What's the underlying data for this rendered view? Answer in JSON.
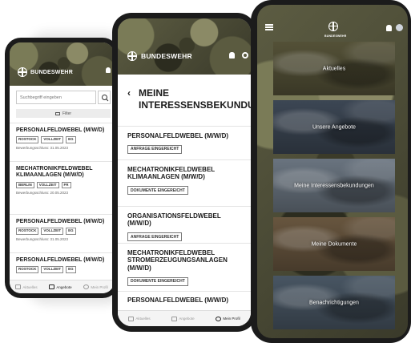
{
  "brand": {
    "name": "BUNDESWEHR"
  },
  "colors": {
    "camo_base": "#4a4a36",
    "header_text": "#ffffff",
    "body_text": "#1b1b1b",
    "device_frame": "#1b1b1b"
  },
  "phone1": {
    "search": {
      "placeholder": "Suchbegriff eingeben"
    },
    "filter_label": "Filter",
    "jobs": [
      {
        "title": "PERSONALFELDWEBEL (M/W/D)",
        "tags": [
          "ROSTOCK",
          "VOLLZEIT",
          "EG"
        ],
        "deadline": "Bewerbungsschluss: 31.05.2023"
      },
      {
        "title": "MECHATRONIKFELDWEBEL KLIMAANLAGEN (M/W/D)",
        "tags": [
          "BERLIN",
          "VOLLZEIT",
          "FR"
        ],
        "deadline": "Bewerbungsschluss: 20.05.2023"
      },
      {
        "title": "PERSONALFELDWEBEL (M/W/D)",
        "tags": [
          "ROSTOCK",
          "VOLLZEIT",
          "EG"
        ],
        "deadline": "Bewerbungsschluss: 31.05.2023"
      },
      {
        "title": "PERSONALFELDWEBEL (M/W/D)",
        "tags": [
          "ROSTOCK",
          "VOLLZEIT",
          "EG"
        ],
        "deadline": ""
      }
    ],
    "tabs": {
      "news": "Aktuelles",
      "offers": "Angebote",
      "profile": "Mein Profil"
    }
  },
  "phone2": {
    "back_icon": "chevron-left-icon",
    "page_title": "MEINE INTERESSENSBEKUNDUNGEN",
    "items": [
      {
        "title": "PERSONALFELDWEBEL (M/W/D)",
        "status": "ANFRAGE EINGEREICHT"
      },
      {
        "title": "MECHATRONIKFELDWEBEL KLIMAANLAGEN (M/W/D)",
        "status": "DOKUMENTE EINGEREICHT"
      },
      {
        "title": "ORGANISATIONSFELDWEBEL (M/W/D)",
        "status": "ANFRAGE EINGEREICHT"
      },
      {
        "title": "MECHATRONIKFELDWEBEL STROMERZEUGUNGSANLAGEN (M/W/D)",
        "status": "DOKUMENTE EINGEREICHT"
      },
      {
        "title": "PERSONALFELDWEBEL (M/W/D)",
        "status": ""
      }
    ],
    "tabs": {
      "news": "Aktuelles",
      "offers": "Angebote",
      "profile": "Mein Profil"
    }
  },
  "phone3": {
    "tiles": [
      {
        "label": "Aktuelles",
        "tone": "#58553a"
      },
      {
        "label": "Unsere Angebote",
        "tone": "#3f4a58"
      },
      {
        "label": "Meine Interessensbekundungen",
        "tone": "#6f7a86"
      },
      {
        "label": "Meine Dokumente",
        "tone": "#6d5a42"
      },
      {
        "label": "Benachrichtigungen",
        "tone": "#4c5a68"
      }
    ]
  }
}
